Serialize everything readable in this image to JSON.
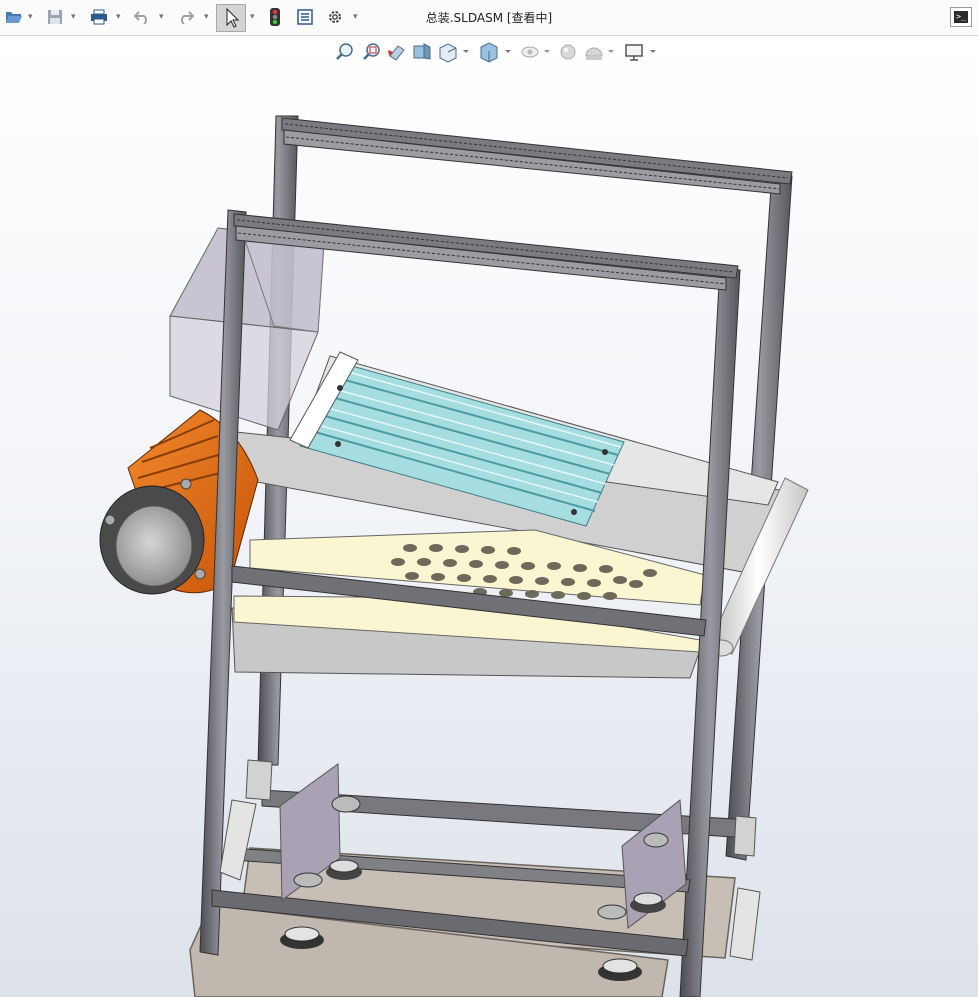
{
  "window": {
    "title": "总装.SLDASM [查看中]"
  },
  "toolbar": {
    "items": [
      {
        "name": "open-file",
        "icon": "folder-open-icon"
      },
      {
        "name": "save",
        "icon": "save-icon"
      },
      {
        "name": "print",
        "icon": "printer-icon"
      },
      {
        "name": "undo",
        "icon": "undo-icon"
      },
      {
        "name": "redo",
        "icon": "redo-icon"
      },
      {
        "name": "select",
        "icon": "cursor-icon"
      },
      {
        "name": "rebuild",
        "icon": "traffic-light-icon"
      },
      {
        "name": "file-properties",
        "icon": "properties-icon"
      },
      {
        "name": "options",
        "icon": "gear-icon"
      }
    ],
    "terminal_label": ">_"
  },
  "view_toolbar": {
    "items": [
      "zoom-to-fit-icon",
      "zoom-to-area-icon",
      "previous-view-icon",
      "section-view-icon",
      "view-orientation-icon",
      "display-style-icon",
      "hide-show-icon",
      "appearance-icon",
      "scene-icon",
      "display-monitor-icon"
    ]
  },
  "colors": {
    "frame": "#6e6e74",
    "motor": "#e86f14",
    "screen": "#9fdce0",
    "tray": "#fbf6d2",
    "hopper": "#b9b4c4",
    "base_plate": "#c6bdb4"
  }
}
